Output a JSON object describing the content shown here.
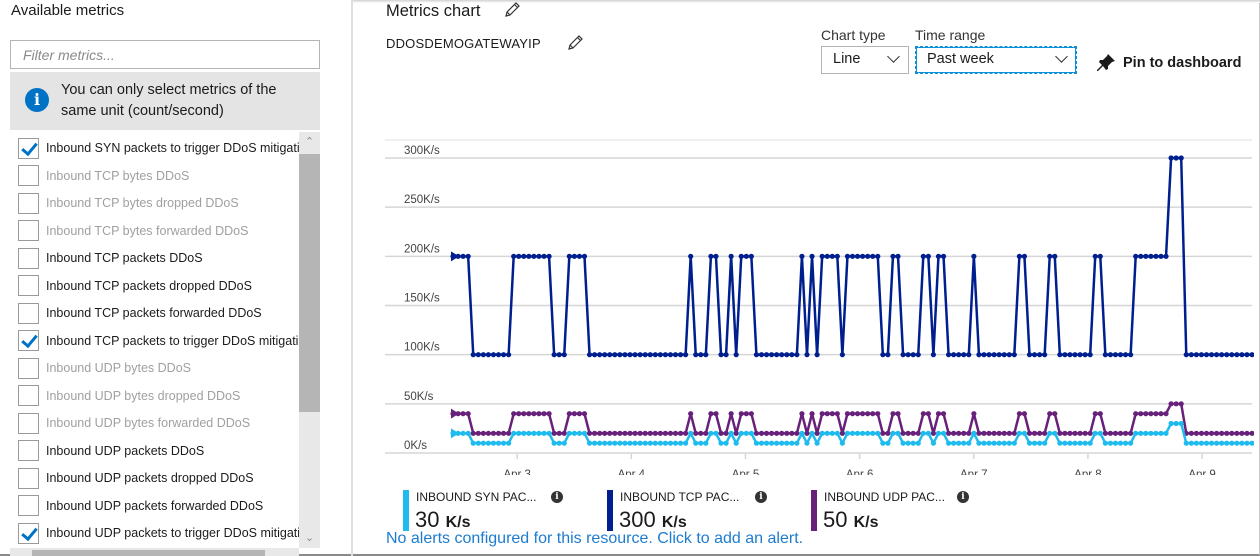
{
  "left_panel": {
    "title": "Available metrics",
    "filter_placeholder": "Filter metrics...",
    "info_text": "You can only select metrics of the same unit (count/second)",
    "metrics": [
      {
        "label": "Inbound SYN packets to trigger DDoS mitigation",
        "checked": true,
        "enabled": true
      },
      {
        "label": "Inbound TCP bytes DDoS",
        "checked": false,
        "enabled": false
      },
      {
        "label": "Inbound TCP bytes dropped DDoS",
        "checked": false,
        "enabled": false
      },
      {
        "label": "Inbound TCP bytes forwarded DDoS",
        "checked": false,
        "enabled": false
      },
      {
        "label": "Inbound TCP packets DDoS",
        "checked": false,
        "enabled": true
      },
      {
        "label": "Inbound TCP packets dropped DDoS",
        "checked": false,
        "enabled": true
      },
      {
        "label": "Inbound TCP packets forwarded DDoS",
        "checked": false,
        "enabled": true
      },
      {
        "label": "Inbound TCP packets to trigger DDoS mitigation",
        "checked": true,
        "enabled": true
      },
      {
        "label": "Inbound UDP bytes DDoS",
        "checked": false,
        "enabled": false
      },
      {
        "label": "Inbound UDP bytes dropped DDoS",
        "checked": false,
        "enabled": false
      },
      {
        "label": "Inbound UDP bytes forwarded DDoS",
        "checked": false,
        "enabled": false
      },
      {
        "label": "Inbound UDP packets DDoS",
        "checked": false,
        "enabled": true
      },
      {
        "label": "Inbound UDP packets dropped DDoS",
        "checked": false,
        "enabled": true
      },
      {
        "label": "Inbound UDP packets forwarded DDoS",
        "checked": false,
        "enabled": true
      },
      {
        "label": "Inbound UDP packets to trigger DDoS mitigation",
        "checked": true,
        "enabled": true
      }
    ]
  },
  "header": {
    "title": "Metrics chart",
    "resource": "DDOSDEMOGATEWAYIP",
    "chart_type_label": "Chart type",
    "chart_type_value": "Line",
    "time_range_label": "Time range",
    "time_range_value": "Past week",
    "pin_label": "Pin to dashboard"
  },
  "colors": {
    "syn": "#1ebbee",
    "tcp": "#001f8f",
    "udp": "#68217a",
    "link": "#1d7cd0",
    "info": "#0072c6"
  },
  "chart_data": {
    "type": "line",
    "title": "",
    "xlabel": "",
    "ylabel": "",
    "ylim": [
      0,
      300
    ],
    "y_unit": "K/s",
    "y_ticks": [
      "0K/s",
      "50K/s",
      "100K/s",
      "150K/s",
      "200K/s",
      "250K/s",
      "300K/s"
    ],
    "y_tick_values": [
      0,
      50,
      100,
      150,
      200,
      250,
      300
    ],
    "x_ticks": [
      "Apr 3",
      "Apr 4",
      "Apr 5",
      "Apr 6",
      "Apr 7",
      "Apr 8",
      "Apr 9"
    ],
    "x_tick_hours": [
      13.5,
      37.5,
      61.5,
      85.5,
      109.5,
      133.5,
      157.5
    ],
    "x_range_hours": [
      0,
      168
    ],
    "grid": true,
    "legend_position": "bottom",
    "note": "Series given as run-length segments of hourly points: [value, count]",
    "series": [
      {
        "name": "Inbound TCP packets to trigger DDoS mitigation",
        "key": "tcp",
        "segments": [
          [
            200,
            4
          ],
          [
            100,
            8
          ],
          [
            200,
            8
          ],
          [
            100,
            3
          ],
          [
            200,
            4
          ],
          [
            100,
            20
          ],
          [
            200,
            1
          ],
          [
            100,
            3
          ],
          [
            200,
            2
          ],
          [
            100,
            2
          ],
          [
            200,
            1
          ],
          [
            100,
            1
          ],
          [
            200,
            3
          ],
          [
            100,
            9
          ],
          [
            200,
            1
          ],
          [
            100,
            1
          ],
          [
            200,
            1
          ],
          [
            100,
            1
          ],
          [
            200,
            4
          ],
          [
            100,
            1
          ],
          [
            200,
            7
          ],
          [
            100,
            2
          ],
          [
            200,
            2
          ],
          [
            100,
            4
          ],
          [
            200,
            2
          ],
          [
            100,
            1
          ],
          [
            200,
            2
          ],
          [
            100,
            5
          ],
          [
            200,
            1
          ],
          [
            100,
            8
          ],
          [
            200,
            2
          ],
          [
            100,
            4
          ],
          [
            200,
            2
          ],
          [
            100,
            7
          ],
          [
            200,
            2
          ],
          [
            100,
            6
          ],
          [
            200,
            7
          ],
          [
            300,
            3
          ],
          [
            100,
            14
          ]
        ]
      },
      {
        "name": "Inbound UDP packets to trigger DDoS mitigation",
        "key": "udp",
        "segments": [
          [
            40,
            4
          ],
          [
            20,
            8
          ],
          [
            40,
            8
          ],
          [
            20,
            3
          ],
          [
            40,
            4
          ],
          [
            20,
            20
          ],
          [
            40,
            1
          ],
          [
            20,
            3
          ],
          [
            40,
            2
          ],
          [
            20,
            2
          ],
          [
            40,
            1
          ],
          [
            20,
            1
          ],
          [
            40,
            3
          ],
          [
            20,
            9
          ],
          [
            40,
            1
          ],
          [
            20,
            1
          ],
          [
            40,
            1
          ],
          [
            20,
            1
          ],
          [
            40,
            4
          ],
          [
            20,
            1
          ],
          [
            40,
            7
          ],
          [
            20,
            2
          ],
          [
            40,
            2
          ],
          [
            20,
            4
          ],
          [
            40,
            2
          ],
          [
            20,
            1
          ],
          [
            40,
            2
          ],
          [
            20,
            5
          ],
          [
            40,
            1
          ],
          [
            20,
            8
          ],
          [
            40,
            2
          ],
          [
            20,
            4
          ],
          [
            40,
            2
          ],
          [
            20,
            7
          ],
          [
            40,
            2
          ],
          [
            20,
            6
          ],
          [
            40,
            7
          ],
          [
            50,
            3
          ],
          [
            20,
            14
          ]
        ]
      },
      {
        "name": "Inbound SYN packets to trigger DDoS mitigation",
        "key": "syn",
        "segments": [
          [
            20,
            4
          ],
          [
            10,
            8
          ],
          [
            20,
            8
          ],
          [
            10,
            3
          ],
          [
            20,
            4
          ],
          [
            10,
            20
          ],
          [
            20,
            1
          ],
          [
            10,
            3
          ],
          [
            20,
            2
          ],
          [
            10,
            2
          ],
          [
            20,
            1
          ],
          [
            10,
            1
          ],
          [
            20,
            3
          ],
          [
            10,
            9
          ],
          [
            20,
            1
          ],
          [
            10,
            1
          ],
          [
            20,
            1
          ],
          [
            10,
            1
          ],
          [
            20,
            4
          ],
          [
            10,
            1
          ],
          [
            20,
            7
          ],
          [
            10,
            2
          ],
          [
            20,
            2
          ],
          [
            10,
            4
          ],
          [
            20,
            2
          ],
          [
            10,
            1
          ],
          [
            20,
            2
          ],
          [
            10,
            5
          ],
          [
            20,
            1
          ],
          [
            10,
            8
          ],
          [
            20,
            2
          ],
          [
            10,
            4
          ],
          [
            20,
            2
          ],
          [
            10,
            7
          ],
          [
            20,
            2
          ],
          [
            10,
            6
          ],
          [
            20,
            7
          ],
          [
            30,
            3
          ],
          [
            10,
            14
          ]
        ]
      }
    ]
  },
  "legend": [
    {
      "name": "INBOUND SYN PAC...",
      "value": "30",
      "unit": "K/s",
      "key": "syn"
    },
    {
      "name": "INBOUND TCP PAC...",
      "value": "300",
      "unit": "K/s",
      "key": "tcp"
    },
    {
      "name": "INBOUND UDP PAC...",
      "value": "50",
      "unit": "K/s",
      "key": "udp"
    }
  ],
  "alert_link": "No alerts configured for this resource. Click to add an alert."
}
